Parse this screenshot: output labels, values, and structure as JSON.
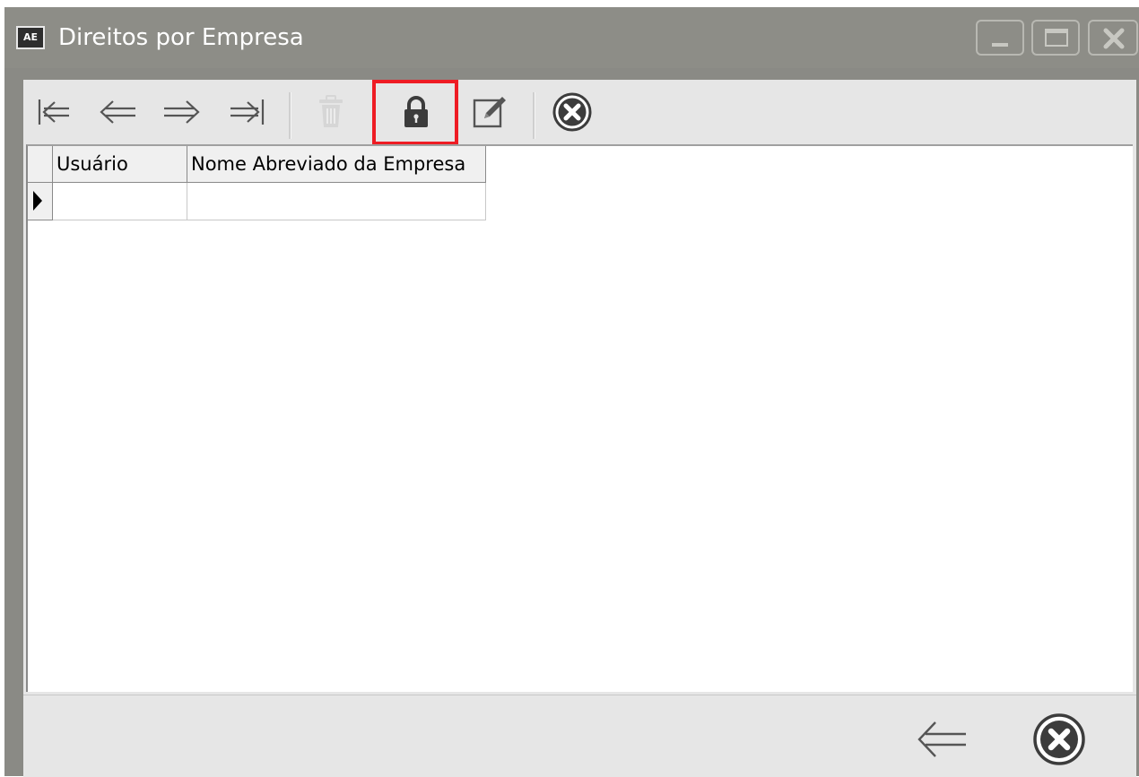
{
  "window": {
    "title": "Direitos por Empresa",
    "app_icon_text": "AE"
  },
  "toolbar": {
    "buttons": [
      {
        "name": "first-record",
        "icon": "first-arrow-icon"
      },
      {
        "name": "previous-record",
        "icon": "left-arrow-icon"
      },
      {
        "name": "next-record",
        "icon": "right-arrow-icon"
      },
      {
        "name": "last-record",
        "icon": "last-arrow-icon"
      },
      {
        "name": "delete",
        "icon": "trash-icon",
        "disabled": true
      },
      {
        "name": "lock",
        "icon": "lock-icon",
        "highlighted": true
      },
      {
        "name": "edit",
        "icon": "edit-icon"
      },
      {
        "name": "cancel",
        "icon": "cancel-circle-icon"
      }
    ],
    "highlight_color": "#ee1c24"
  },
  "grid": {
    "columns": [
      "Usuário",
      "Nome Abreviado da Empresa"
    ],
    "rows": [
      [
        "",
        ""
      ]
    ]
  },
  "footer": {
    "buttons": [
      {
        "name": "back",
        "icon": "back-arrow-icon"
      },
      {
        "name": "close",
        "icon": "cancel-circle-icon"
      }
    ]
  },
  "colors": {
    "titlebar": "#8d8d87",
    "client": "#e6e6e6",
    "icon_dark": "#3c3c3c"
  }
}
